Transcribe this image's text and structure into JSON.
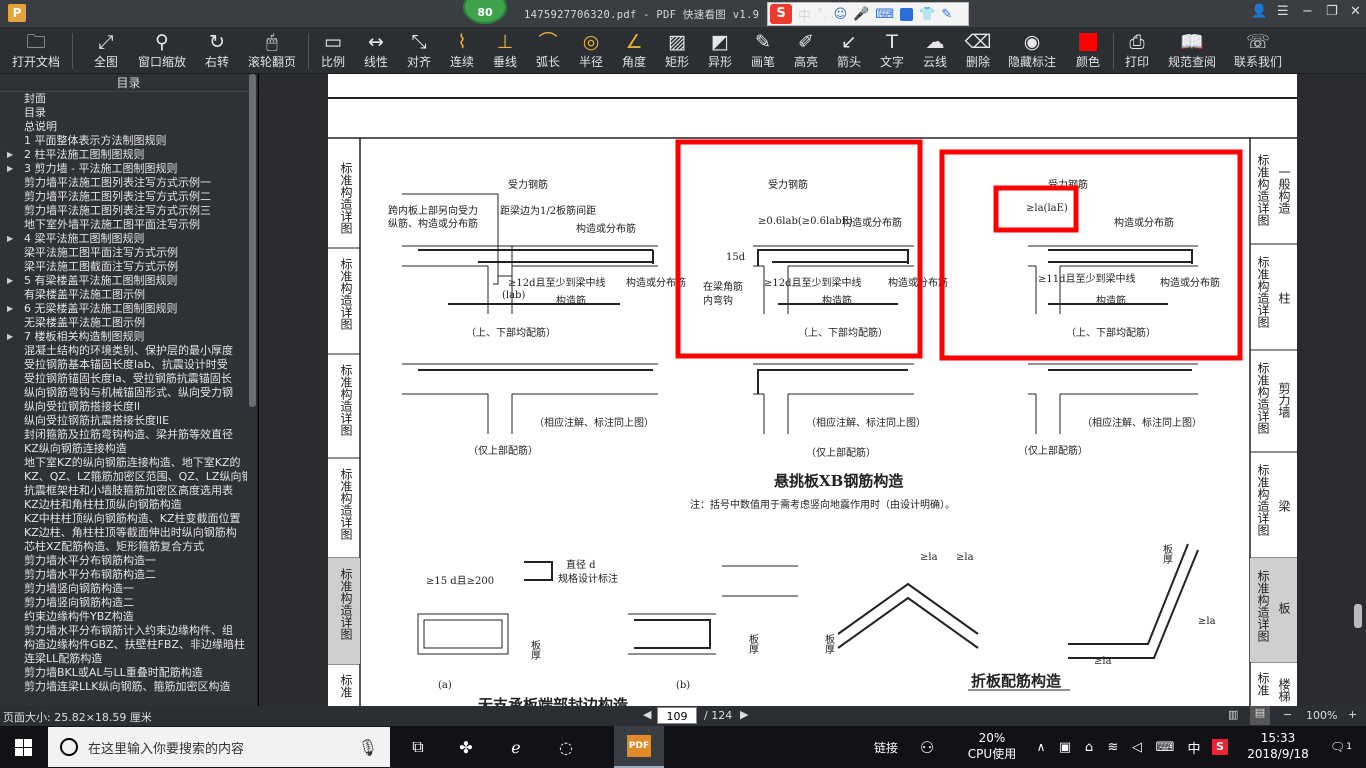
{
  "window": {
    "title": "1475927706320.pdf - PDF 快速看图 v1.9",
    "app_icon": "P",
    "badge": "80"
  },
  "ime": {
    "logo": "S",
    "items": [
      "中",
      "°,",
      "☺",
      "🎤",
      "⌨",
      "👕",
      "✎"
    ]
  },
  "toolbar": {
    "open": "打开文档",
    "full": "全图",
    "window_zoom": "窗口缩放",
    "rotate": "右转",
    "scroll_page": "滚轮翻页",
    "scale": "比例",
    "linear": "线性",
    "align": "对齐",
    "continuous": "连续",
    "vertical": "垂线",
    "arc": "弧长",
    "radius": "半径",
    "angle": "角度",
    "rect": "矩形",
    "shaped": "异形",
    "pen": "画笔",
    "highlight": "高亮",
    "arrow": "箭头",
    "text": "文字",
    "cloud": "云线",
    "delete": "删除",
    "hide_marks": "隐藏标注",
    "color": "颜色",
    "print": "打印",
    "spec": "规范查阅",
    "contact": "联系我们"
  },
  "sidebar": {
    "header": "目录",
    "items": [
      {
        "label": "封面",
        "arrow": ""
      },
      {
        "label": "目录",
        "arrow": ""
      },
      {
        "label": "总说明",
        "arrow": ""
      },
      {
        "label": "1 平面整体表示方法制图规则",
        "arrow": ""
      },
      {
        "label": "2 柱平法施工图制图规则",
        "arrow": "▶"
      },
      {
        "label": "3 剪力墙 - 平法施工图制图规则",
        "arrow": "▶"
      },
      {
        "label": "剪力墙平法施工图列表注写方式示例一",
        "arrow": ""
      },
      {
        "label": "剪力墙平法施工图列表注写方式示例二",
        "arrow": ""
      },
      {
        "label": "剪力墙平法施工图列表注写方式示例三",
        "arrow": ""
      },
      {
        "label": "地下室外墙平法施工图平面注写示例",
        "arrow": ""
      },
      {
        "label": "4 梁平法施工图制图规则",
        "arrow": "▶"
      },
      {
        "label": "梁平法施工图平面注写方式示例",
        "arrow": ""
      },
      {
        "label": "梁平法施工图截面注写方式示例",
        "arrow": ""
      },
      {
        "label": "5 有梁楼盖平法施工图制图规则",
        "arrow": "▶"
      },
      {
        "label": "有梁楼盖平法施工图示例",
        "arrow": ""
      },
      {
        "label": "6 无梁楼盖平法施工图制图规则",
        "arrow": "▶"
      },
      {
        "label": "无梁楼盖平法施工图示例",
        "arrow": ""
      },
      {
        "label": "7 楼板相关构造制图规则",
        "arrow": "▶"
      },
      {
        "label": "混凝土结构的环境类别、保护层的最小厚度",
        "arrow": ""
      },
      {
        "label": "受拉钢筋基本锚固长度lab、抗震设计时受",
        "arrow": ""
      },
      {
        "label": "受拉钢筋锚固长度la、受拉钢筋抗震锚固长",
        "arrow": ""
      },
      {
        "label": "纵向钢筋弯钩与机械锚固形式、纵向受力钢",
        "arrow": ""
      },
      {
        "label": "纵向受拉钢筋搭接长度ll",
        "arrow": ""
      },
      {
        "label": "纵向受拉钢筋抗震搭接长度llE",
        "arrow": ""
      },
      {
        "label": "封闭箍筋及拉筋弯钩构造、梁并筋等效直径",
        "arrow": ""
      },
      {
        "label": "KZ纵向钢筋连接构造",
        "arrow": ""
      },
      {
        "label": "地下室KZ的纵向钢筋连接构造、地下室KZ的",
        "arrow": ""
      },
      {
        "label": "KZ、QZ、LZ箍筋加密区范围、QZ、LZ纵向钢",
        "arrow": ""
      },
      {
        "label": "抗震框架柱和小墙肢箍筋加密区高度选用表",
        "arrow": ""
      },
      {
        "label": "KZ边柱和角柱柱顶纵向钢筋构造",
        "arrow": ""
      },
      {
        "label": "KZ中柱柱顶纵向钢筋构造、KZ柱变截面位置",
        "arrow": ""
      },
      {
        "label": "KZ边柱、角柱柱顶等截面伸出时纵向钢筋构",
        "arrow": ""
      },
      {
        "label": "芯柱XZ配筋构造、矩形箍筋复合方式",
        "arrow": ""
      },
      {
        "label": "剪力墙水平分布钢筋构造一",
        "arrow": ""
      },
      {
        "label": "剪力墙水平分布钢筋构造二",
        "arrow": ""
      },
      {
        "label": "剪力墙竖向钢筋构造一",
        "arrow": ""
      },
      {
        "label": "剪力墙竖向钢筋构造二",
        "arrow": ""
      },
      {
        "label": "约束边缘构件YBZ构造",
        "arrow": ""
      },
      {
        "label": "剪力墙水平分布钢筋计入约束边缘构件、组",
        "arrow": ""
      },
      {
        "label": "构造边缘构件GBZ、扶壁柱FBZ、非边缘暗柱",
        "arrow": ""
      },
      {
        "label": "连梁LL配筋构造",
        "arrow": ""
      },
      {
        "label": "剪力墙BKL或AL与LL重叠时配筋构造",
        "arrow": ""
      },
      {
        "label": "剪力墙连梁LLK纵向钢筋、箍筋加密区构造",
        "arrow": ""
      }
    ]
  },
  "drawing": {
    "left_tabs": [
      "标准构造详图",
      "标准构造详图",
      "标准构造详图",
      "标准构造详图",
      "标准构造详图",
      "标准"
    ],
    "right_tabs": [
      {
        "t": "标准构造详图",
        "s": "一般构造"
      },
      {
        "t": "标准构造详图",
        "s": "柱"
      },
      {
        "t": "标准构造详图",
        "s": "剪力墙"
      },
      {
        "t": "标准构造详图",
        "s": "梁"
      },
      {
        "t": "标准构造详图",
        "s": "板"
      },
      {
        "t": "标准",
        "s": "楼梯"
      }
    ],
    "a1": "受力钢筋",
    "a2": "跨内板上部另向受力",
    "a3": "纵筋、构造或分布筋",
    "a4": "距梁边为1/2板筋间距",
    "a5": "构造或分布筋",
    "a6": "≥12d且至少到梁中线",
    "a7": "构造或分布筋",
    "a8": "构造筋",
    "a9": "(lab)",
    "cap": "（上、下部均配筋）",
    "b1": "受力钢筋",
    "b2": "≥0.6lab(≥0.6labE)",
    "b3": "构造或分布筋",
    "b4": "15d",
    "b5": "在梁角筋",
    "b6": "内弯钩",
    "b7": "≥12d且至少到梁中线",
    "b8": "构造或分布筋",
    "b9": "构造筋",
    "c1": "受力钢筋",
    "c2": "≥la(laE)",
    "c3": "构造或分布筋",
    "c4": "≥11d且至少到梁中线",
    "c5": "构造或分布筋",
    "c6": "构造筋",
    "note2": "（相应注解、标注同上图）",
    "cap2": "（仅上部配筋）",
    "title1": "悬挑板XB钢筋构造",
    "note": "注：括号中数值用于需考虑竖向地震作用时（由设计明确）。",
    "d1": "直径 d",
    "d2": "规格设计标注",
    "d3": "≥15 d且≥200",
    "d4": "板厚",
    "da": "(a)",
    "db": "(b)",
    "e1": "板厚",
    "e2": "≥la",
    "e3": "板厚",
    "title2": "折板配筋构造",
    "title3": "无支承板端部封边构造"
  },
  "statusbar": {
    "page_size": "页面大小: 25.82×18.59 厘米",
    "page_current": "109",
    "page_total": "/ 124",
    "zoom": "100%",
    "minus": "−",
    "plus": "+"
  },
  "taskbar": {
    "search_placeholder": "在这里输入你要搜索的内容",
    "link": "链接",
    "cpu": "20%",
    "cpu_label": "CPU使用",
    "ime": "中",
    "time": "15:33",
    "date": "2018/9/18",
    "notif": "1"
  }
}
